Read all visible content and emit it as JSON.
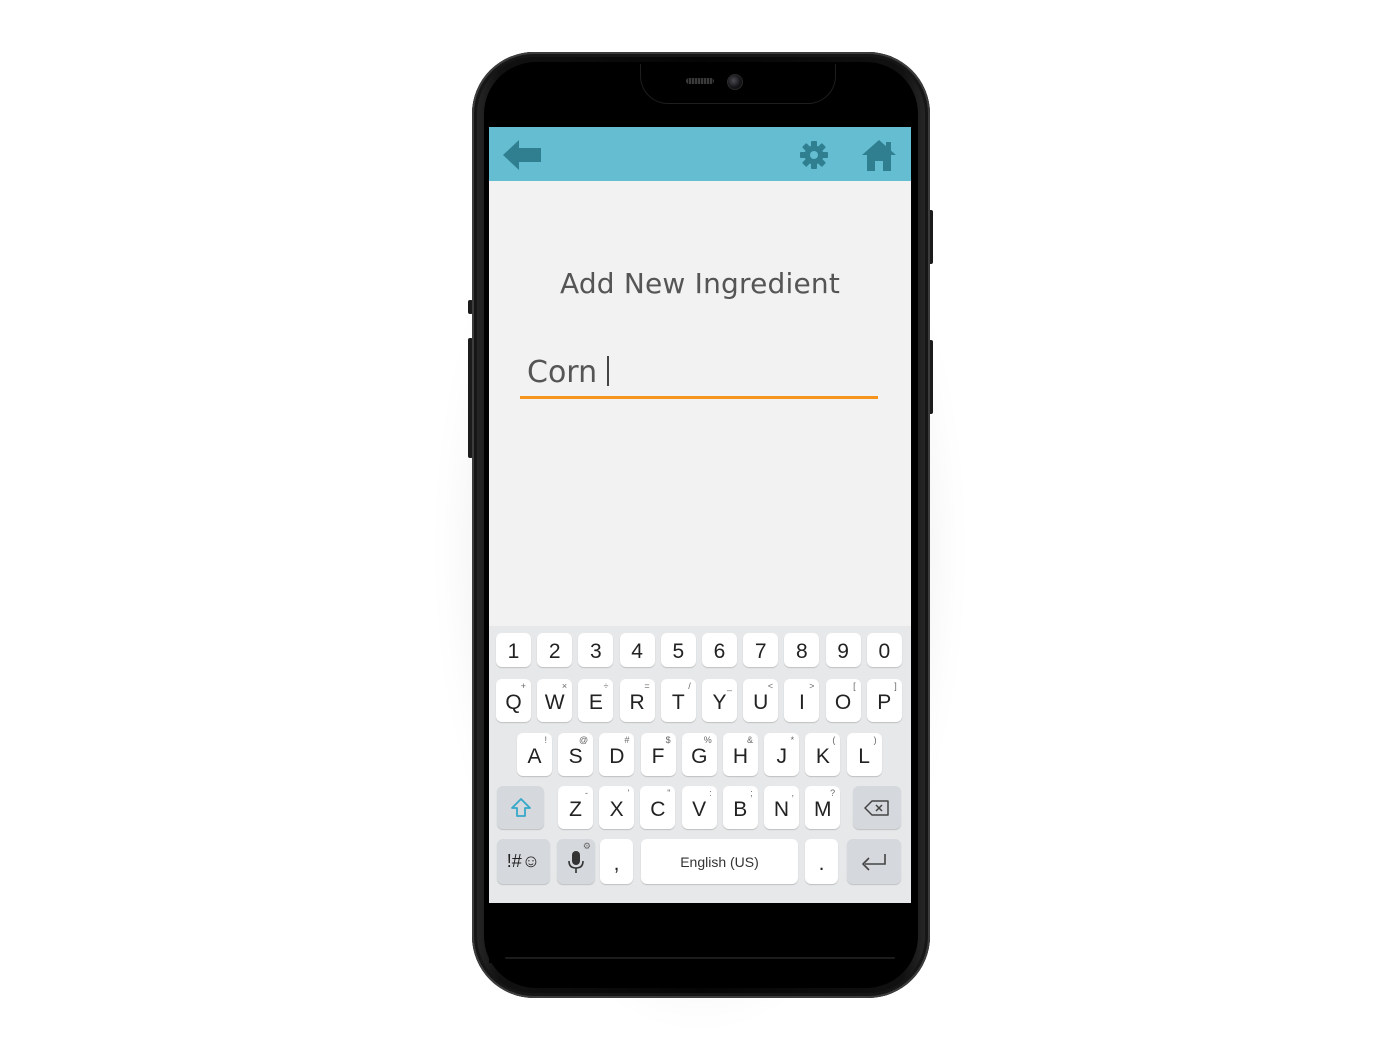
{
  "header": {
    "back_icon": "back-arrow-icon",
    "settings_icon": "gear-icon",
    "home_icon": "home-icon",
    "bar_color": "#64bdd0",
    "icon_color": "#2f7f90"
  },
  "main": {
    "title": "Add New Ingredient",
    "input_value": "Corn",
    "underline_color": "#f7941d"
  },
  "keyboard": {
    "number_row": [
      "1",
      "2",
      "3",
      "4",
      "5",
      "6",
      "7",
      "8",
      "9",
      "0"
    ],
    "row1": [
      {
        "key": "Q",
        "alt": "+"
      },
      {
        "key": "W",
        "alt": "×"
      },
      {
        "key": "E",
        "alt": "÷"
      },
      {
        "key": "R",
        "alt": "="
      },
      {
        "key": "T",
        "alt": "/"
      },
      {
        "key": "Y",
        "alt": "_"
      },
      {
        "key": "U",
        "alt": "<"
      },
      {
        "key": "I",
        "alt": ">"
      },
      {
        "key": "O",
        "alt": "["
      },
      {
        "key": "P",
        "alt": "]"
      }
    ],
    "row2": [
      {
        "key": "A",
        "alt": "!"
      },
      {
        "key": "S",
        "alt": "@"
      },
      {
        "key": "D",
        "alt": "#"
      },
      {
        "key": "F",
        "alt": "$"
      },
      {
        "key": "G",
        "alt": "%"
      },
      {
        "key": "H",
        "alt": "&"
      },
      {
        "key": "J",
        "alt": "*"
      },
      {
        "key": "K",
        "alt": "("
      },
      {
        "key": "L",
        "alt": ")"
      }
    ],
    "row3": [
      {
        "key": "Z",
        "alt": "-"
      },
      {
        "key": "X",
        "alt": "'"
      },
      {
        "key": "C",
        "alt": "\""
      },
      {
        "key": "V",
        "alt": ":"
      },
      {
        "key": "B",
        "alt": ";"
      },
      {
        "key": "N",
        "alt": ","
      },
      {
        "key": "M",
        "alt": "?"
      }
    ],
    "shift_icon": "shift-arrow-icon",
    "backspace_icon": "backspace-icon",
    "symbols_label": "!#☺",
    "mic_icon": "microphone-icon",
    "comma_label": ",",
    "space_label": "English (US)",
    "period_label": ".",
    "enter_icon": "enter-icon",
    "accent_color": "#35a8c9"
  }
}
